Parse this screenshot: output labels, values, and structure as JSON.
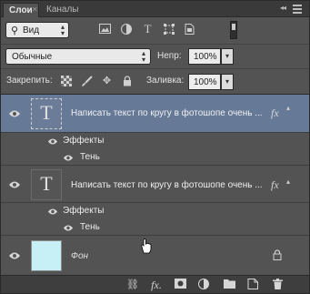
{
  "tabs": [
    {
      "label": "Слои",
      "active": true
    },
    {
      "label": "Каналы",
      "active": false
    }
  ],
  "panel_controls": {
    "collapse": "◂◂",
    "close": "✕"
  },
  "filter": {
    "kind_label": "Вид",
    "icons": [
      "image-filter-icon",
      "adjustment-filter-icon",
      "type-filter-icon",
      "shape-filter-icon",
      "smart-object-filter-icon"
    ]
  },
  "blend": {
    "mode": "Обычные",
    "opacity_label": "Непр:",
    "opacity_value": "100%",
    "fill_label": "Заливка:",
    "fill_value": "100%"
  },
  "lock": {
    "label": "Закрепить:"
  },
  "layers": [
    {
      "name": "Написать текст по кругу в фотошопе очень ...",
      "type": "text",
      "thumb_glyph": "T",
      "selected": true,
      "fx": "fx",
      "effects_label": "Эффекты",
      "effects": [
        "Тень"
      ]
    },
    {
      "name": "Написать текст по кругу в фотошопе очень ...",
      "type": "text",
      "thumb_glyph": "T",
      "selected": false,
      "fx": "fx",
      "effects_label": "Эффекты",
      "effects": [
        "Тень"
      ]
    },
    {
      "name": "Фон",
      "type": "background",
      "thumb_color": "#c6f0f5",
      "locked": true
    }
  ],
  "toolbar": {
    "fx_label": "fx."
  },
  "colors": {
    "panel_bg": "#535353",
    "selected_row": "#667a98",
    "thumb_bg": "#c6f0f5"
  }
}
